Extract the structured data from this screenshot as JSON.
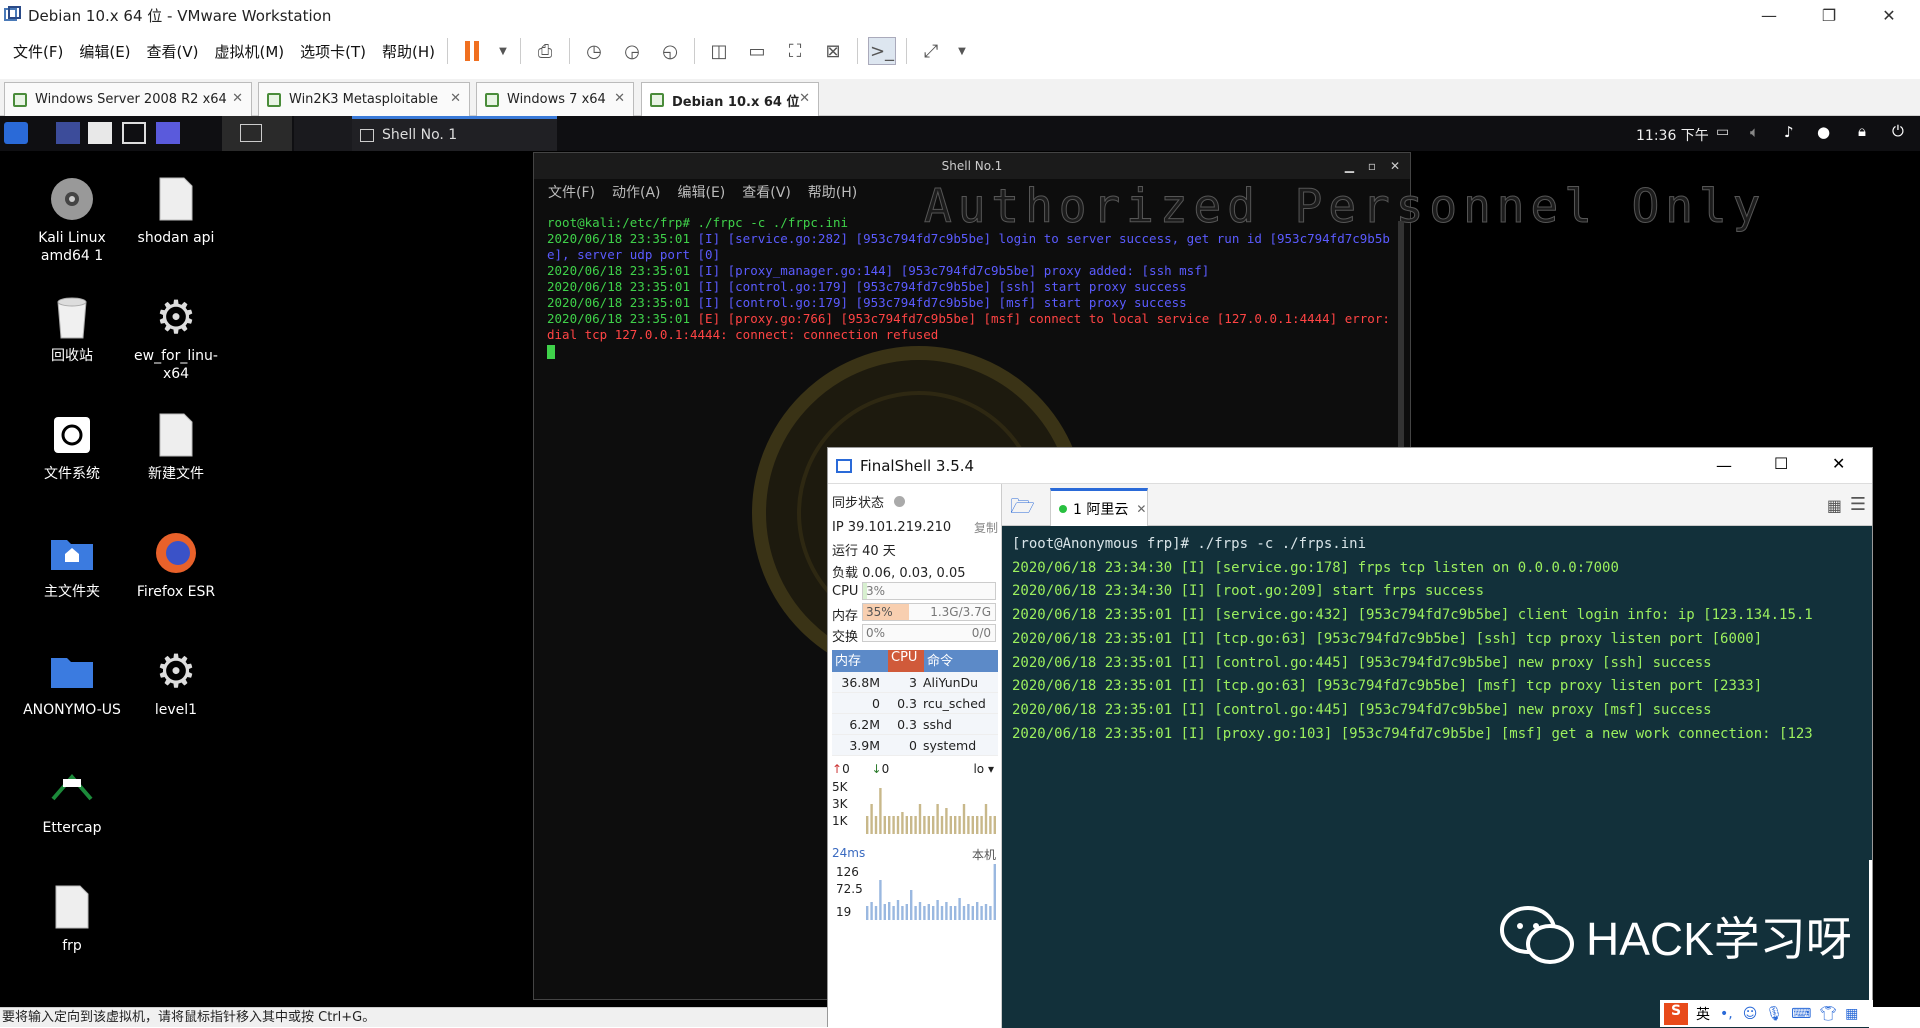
{
  "vmware": {
    "title": "Debian 10.x 64 位 - VMware Workstation",
    "menu": [
      "文件(F)",
      "编辑(E)",
      "查看(V)",
      "虚拟机(M)",
      "选项卡(T)",
      "帮助(H)"
    ],
    "tabs": [
      "Windows Server 2008 R2 x64",
      "Win2K3 Metasploitable",
      "Windows 7 x64",
      "Debian 10.x 64 位"
    ],
    "active_tab": "Debian 10.x 64 位",
    "status_text": "要将输入定向到该虚拟机，请将鼠标指针移入其中或按 Ctrl+G。"
  },
  "kali_panel": {
    "task_label": "Shell No. 1",
    "clock": "11:36 下午"
  },
  "desktop_icons": [
    {
      "label": "Kali Linux amd64 1",
      "icon": "disc-icon"
    },
    {
      "label": "shodan api",
      "icon": "document-icon"
    },
    {
      "label": "回收站",
      "icon": "trash-icon"
    },
    {
      "label": "ew_for_linu-x64",
      "icon": "gear-icon"
    },
    {
      "label": "文件系统",
      "icon": "drive-icon"
    },
    {
      "label": "新建文件",
      "icon": "document-icon"
    },
    {
      "label": "主文件夹",
      "icon": "home-folder-icon"
    },
    {
      "label": "Firefox ESR",
      "icon": "firefox-icon"
    },
    {
      "label": "ANONYMO-US",
      "icon": "folder-icon"
    },
    {
      "label": "level1",
      "icon": "gear-icon"
    },
    {
      "label": "Ettercap",
      "icon": "ettercap-icon"
    },
    {
      "label": "frp",
      "icon": "document-icon"
    }
  ],
  "shell": {
    "title": "Shell No.1",
    "menu": [
      "文件(F)",
      "动作(A)",
      "编辑(E)",
      "查看(V)",
      "帮助(H)"
    ],
    "watermark": "Authorized Personnel Only",
    "lines": [
      {
        "parts": [
          {
            "c": "g",
            "t": "root@kali:/etc/frp# ./frpc -c ./frpc.ini"
          }
        ]
      },
      {
        "parts": [
          {
            "c": "g",
            "t": "2020/06/18 23:35:01 "
          },
          {
            "c": "b",
            "t": "[I] [service.go:282] [953c794fd7c9b5be] login to server success, get run id [953c794fd7c9b5be], server udp port [0]"
          }
        ]
      },
      {
        "parts": [
          {
            "c": "g",
            "t": "2020/06/18 23:35:01 "
          },
          {
            "c": "b",
            "t": "[I] [proxy_manager.go:144] [953c794fd7c9b5be] proxy added: [ssh msf]"
          }
        ]
      },
      {
        "parts": [
          {
            "c": "g",
            "t": "2020/06/18 23:35:01 "
          },
          {
            "c": "b",
            "t": "[I] [control.go:179] [953c794fd7c9b5be] [ssh] start proxy success"
          }
        ]
      },
      {
        "parts": [
          {
            "c": "g",
            "t": "2020/06/18 23:35:01 "
          },
          {
            "c": "b",
            "t": "[I] [control.go:179] [953c794fd7c9b5be] [msf] start proxy success"
          }
        ]
      },
      {
        "parts": [
          {
            "c": "g",
            "t": "2020/06/18 23:35:01 "
          },
          {
            "c": "r",
            "t": "[E] [proxy.go:766] [953c794fd7c9b5be] [msf] connect to local service [127.0.0.1:4444] error: dial tcp 127.0.0.1:4444: connect: connection refused"
          }
        ]
      }
    ]
  },
  "finalshell": {
    "title": "FinalShell 3.5.4",
    "sync_label": "同步状态",
    "ip": "IP 39.101.219.210",
    "copy": "复制",
    "uptime": "运行 40 天",
    "load": "负载 0.06, 0.03, 0.05",
    "cpu_label": "CPU",
    "cpu_value": "3%",
    "cpu_pct": 3,
    "mem_label": "内存",
    "mem_value": "35%",
    "mem_pct": 35,
    "mem_total": "1.3G/3.7G",
    "swap_label": "交换",
    "swap_value": "0%",
    "swap_total": "0/0",
    "proc_headers": [
      "内存",
      "CPU",
      "命令"
    ],
    "processes": [
      {
        "mem": "36.8M",
        "cpu": "3",
        "cmd": "AliYunDu"
      },
      {
        "mem": "0",
        "cpu": "0.3",
        "cmd": "rcu_sched"
      },
      {
        "mem": "6.2M",
        "cpu": "0.3",
        "cmd": "sshd"
      },
      {
        "mem": "3.9M",
        "cpu": "0",
        "cmd": "systemd"
      }
    ],
    "net_up": "0",
    "net_down": "0",
    "net_iface": "lo",
    "net_ticks": [
      "5K",
      "3K",
      "1K"
    ],
    "ping_label": "24ms",
    "ping_host": "本机",
    "ping_ticks": [
      "126",
      "72.5",
      "19"
    ],
    "session_tab": "1 阿里云",
    "terminal_lines": [
      {
        "t": "[root@Anonymous frp]# ./frps -c ./frps.ini",
        "c": "fw"
      },
      {
        "t": "2020/06/18 23:34:30 [I] [service.go:178] frps tcp listen on 0.0.0.0:7000",
        "c": "fg"
      },
      {
        "t": "2020/06/18 23:34:30 [I] [root.go:209] start frps success",
        "c": "fg"
      },
      {
        "t": "2020/06/18 23:35:01 [I] [service.go:432] [953c794fd7c9b5be] client login info: ip [123.134.15.1",
        "c": "fg"
      },
      {
        "t": "2020/06/18 23:35:01 [I] [tcp.go:63] [953c794fd7c9b5be] [ssh] tcp proxy listen port [6000]",
        "c": "fg"
      },
      {
        "t": "2020/06/18 23:35:01 [I] [control.go:445] [953c794fd7c9b5be] new proxy [ssh] success",
        "c": "fg"
      },
      {
        "t": "2020/06/18 23:35:01 [I] [tcp.go:63] [953c794fd7c9b5be] [msf] tcp proxy listen port [2333]",
        "c": "fg"
      },
      {
        "t": "2020/06/18 23:35:01 [I] [control.go:445] [953c794fd7c9b5be] new proxy [msf] success",
        "c": "fg"
      },
      {
        "t": "2020/06/18 23:35:01 [I] [proxy.go:103] [953c794fd7c9b5be] [msf] get a new work connection: [123",
        "c": "fg"
      }
    ]
  },
  "overlay": {
    "wechat_text": "HACK学习呀",
    "ime_lang": "英"
  }
}
